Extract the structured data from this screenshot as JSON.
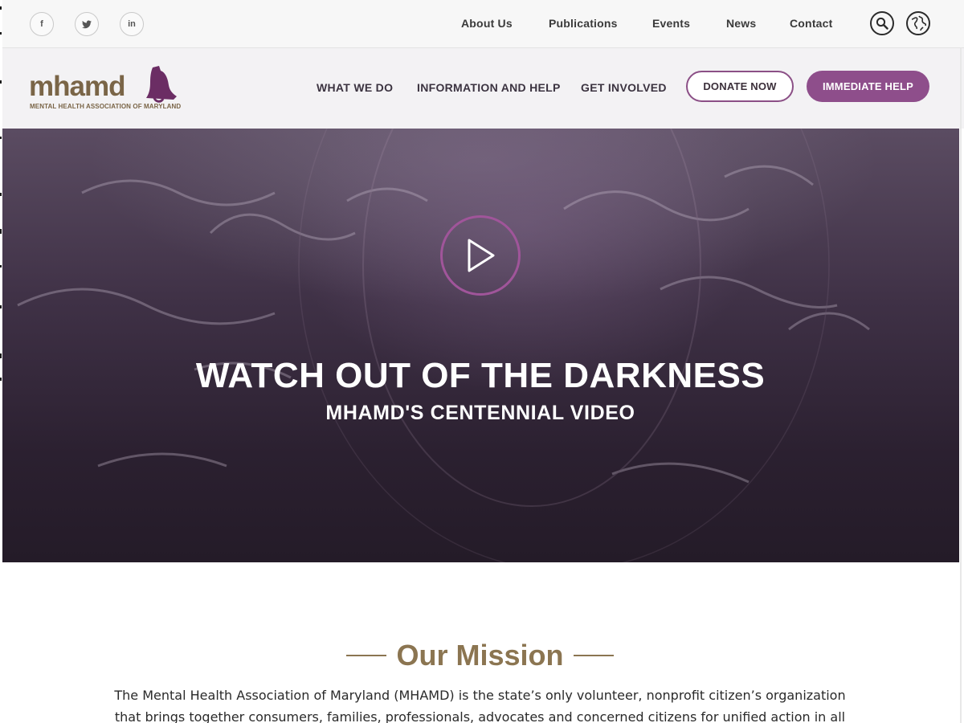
{
  "topbar": {
    "social": [
      {
        "name": "facebook",
        "glyph": "f"
      },
      {
        "name": "twitter",
        "glyph": "t"
      },
      {
        "name": "linkedin",
        "glyph": "in"
      }
    ],
    "links": [
      "About Us",
      "Publications",
      "Events",
      "News",
      "Contact"
    ],
    "icons": [
      "search-icon",
      "globe-icon"
    ]
  },
  "header": {
    "logo_word": "mhamd",
    "logo_tagline": "MENTAL HEALTH ASSOCIATION OF MARYLAND",
    "nav": [
      "WHAT WE DO",
      "INFORMATION AND HELP",
      "GET INVOLVED"
    ],
    "donate_label": "DONATE NOW",
    "help_label": "IMMEDIATE HELP"
  },
  "hero": {
    "title": "WATCH OUT OF THE DARKNESS",
    "subtitle": "MHAMD'S CENTENNIAL VIDEO"
  },
  "mission": {
    "title": "Our Mission",
    "text": "The Mental Health Association of Maryland (MHAMD) is the state’s only volunteer, nonprofit citizen’s organization that brings together consumers, families, professionals, advocates and concerned citizens for unified action in all aspects of mental health and"
  },
  "colors": {
    "accent_purple": "#8e4e8b",
    "brand_gold": "#8b7551",
    "hero_dark": "#2b2030"
  }
}
